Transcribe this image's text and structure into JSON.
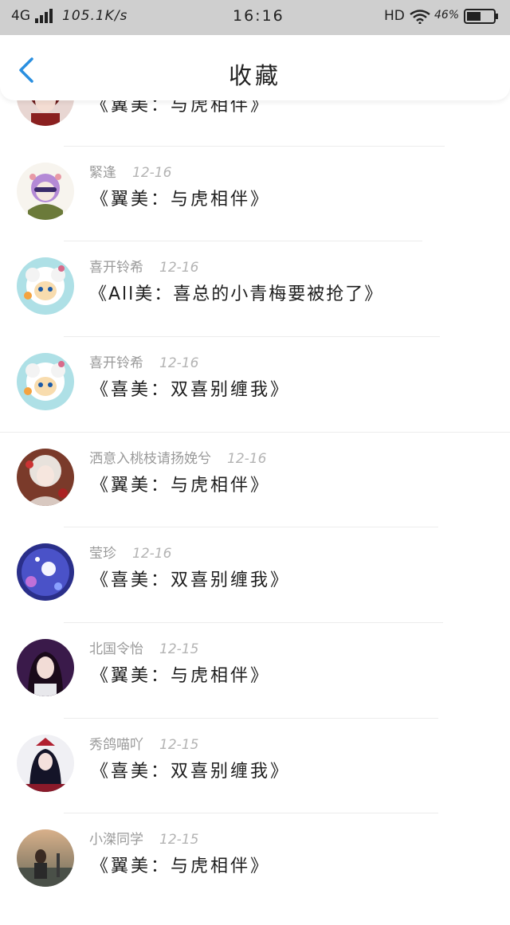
{
  "status_bar": {
    "network": "4G",
    "speed": "105.1K/s",
    "time": "16:16",
    "hd": "HD",
    "battery": "46%"
  },
  "header": {
    "title": "收藏"
  },
  "items": [
    {
      "name": "",
      "date": "",
      "content": "《翼美：与虎相伴》",
      "avatar": "avatar-red-haired-girl"
    },
    {
      "name": "緊逢",
      "date": "12-16",
      "content": "《翼美：与虎相伴》",
      "avatar": "avatar-purple-cartoon"
    },
    {
      "name": "喜开铃希",
      "date": "12-16",
      "content": "《All美：喜总的小青梅要被抢了》",
      "avatar": "avatar-sheep-cartoon"
    },
    {
      "name": "喜开铃希",
      "date": "12-16",
      "content": "《喜美：双喜别缠我》",
      "avatar": "avatar-sheep-cartoon"
    },
    {
      "name": "洒意入桃枝请扬娩兮",
      "date": "12-16",
      "content": "《翼美：与虎相伴》",
      "avatar": "avatar-anime-girl"
    },
    {
      "name": "莹珍",
      "date": "12-16",
      "content": "《喜美：双喜别缠我》",
      "avatar": "avatar-night-moon"
    },
    {
      "name": "北国令怡",
      "date": "12-15",
      "content": "《翼美：与虎相伴》",
      "avatar": "avatar-dark-girl"
    },
    {
      "name": "秀鸽喵吖",
      "date": "12-15",
      "content": "《喜美：双喜别缠我》",
      "avatar": "avatar-gothic-girl"
    },
    {
      "name": "小滐同学",
      "date": "12-15",
      "content": "《翼美：与虎相伴》",
      "avatar": "avatar-sunset-photo"
    }
  ]
}
